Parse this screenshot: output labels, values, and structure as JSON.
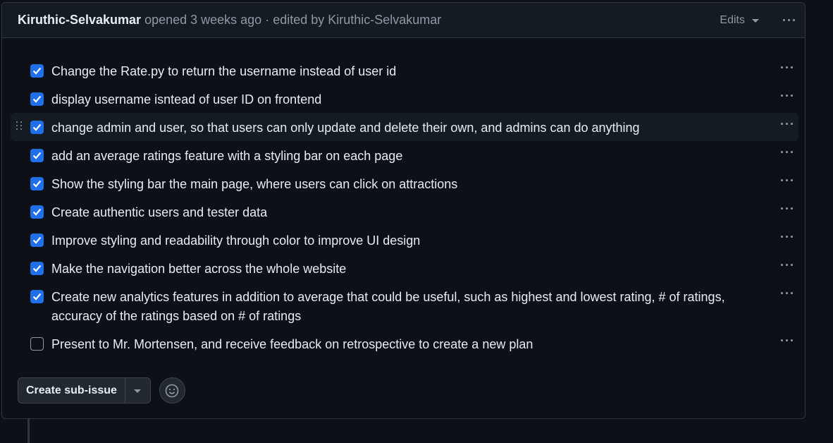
{
  "header": {
    "author": "Kiruthic-Selvakumar",
    "meta_text": " opened 3 weeks ago · edited by Kiruthic-Selvakumar",
    "edits_label": "Edits"
  },
  "tasks": [
    {
      "text": "Change the Rate.py to return the username instead of user id",
      "checked": true
    },
    {
      "text": "display username isntead of user ID on frontend",
      "checked": true
    },
    {
      "text": "change admin and user, so that users can only update and delete their own, and admins can do anything",
      "checked": true
    },
    {
      "text": "add an average ratings feature with a styling bar on each page",
      "checked": true
    },
    {
      "text": "Show the styling bar the main page, where users can click on attractions",
      "checked": true
    },
    {
      "text": "Create authentic users and tester data",
      "checked": true
    },
    {
      "text": "Improve styling and readability through color to improve UI design",
      "checked": true
    },
    {
      "text": "Make the navigation better across the whole website",
      "checked": true
    },
    {
      "text": "Create new analytics features in addition to average that could be useful, such as highest and lowest rating, # of ratings, accuracy of the ratings based on # of ratings",
      "checked": true
    },
    {
      "text": "Present to Mr. Mortensen, and receive feedback on retrospective to create a new plan",
      "checked": false
    }
  ],
  "footer": {
    "create_sub_issue_label": "Create sub-issue"
  },
  "colors": {
    "accent": "#1f6feb",
    "background": "#0d1117",
    "header_bg": "#151b23"
  },
  "icons": [
    "kebab-menu-icon",
    "caret-down-icon",
    "checkmark-icon",
    "drag-handle-icon",
    "smiley-icon"
  ]
}
